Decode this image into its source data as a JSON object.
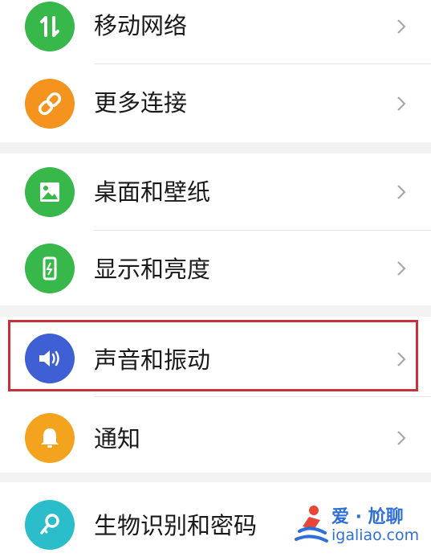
{
  "settings": {
    "items": [
      {
        "label": "移动网络",
        "icon": "mobile-data-icon",
        "color": "#38b84b"
      },
      {
        "label": "更多连接",
        "icon": "link-icon",
        "color": "#f4931e"
      },
      {
        "label": "桌面和壁纸",
        "icon": "picture-icon",
        "color": "#38b84b"
      },
      {
        "label": "显示和亮度",
        "icon": "phone-brightness-icon",
        "color": "#38b84b"
      },
      {
        "label": "声音和振动",
        "icon": "speaker-icon",
        "color": "#3f5fd4"
      },
      {
        "label": "通知",
        "icon": "bell-icon",
        "color": "#f4a31e"
      },
      {
        "label": "生物识别和密码",
        "icon": "key-icon",
        "color": "#2bbdc9"
      }
    ],
    "highlighted_item": "声音和振动"
  },
  "watermark": {
    "title": "爱 · 尬聊",
    "site": "igaliao.com"
  }
}
